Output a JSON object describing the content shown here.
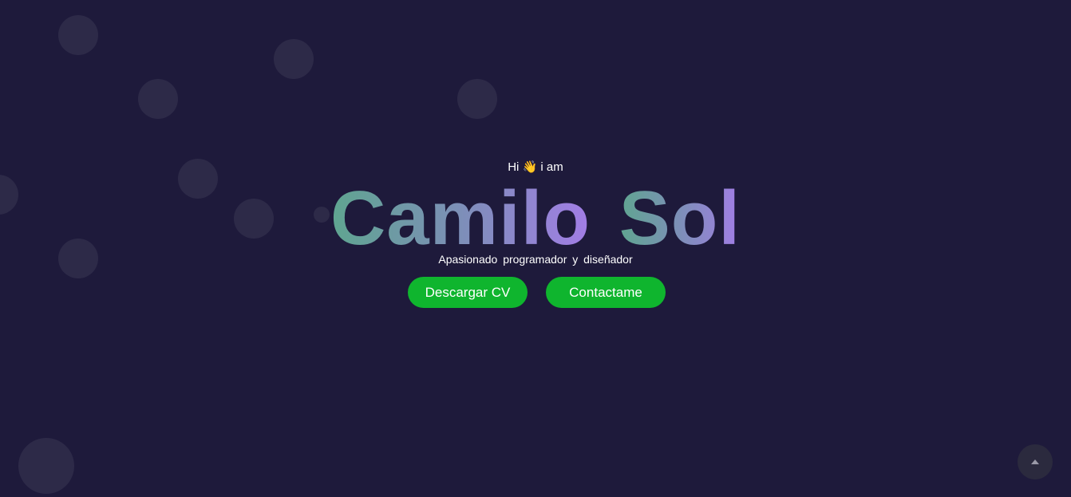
{
  "hero": {
    "greeting_prefix": "Hi",
    "greeting_emoji": "👋",
    "greeting_suffix": "i am",
    "first_name": "Camilo",
    "last_name": "Sol",
    "tagline": "Apasionado programador y diseñador"
  },
  "actions": {
    "download_cv_label": "Descargar CV",
    "contact_label": "Contactame"
  },
  "scroll_top": {
    "icon": "triangle-up-icon"
  },
  "colors": {
    "background": "#1e1a3b",
    "button": "#0fb52e",
    "name_gradient_start": "#5fa590",
    "name_gradient_end": "#a27de6"
  }
}
